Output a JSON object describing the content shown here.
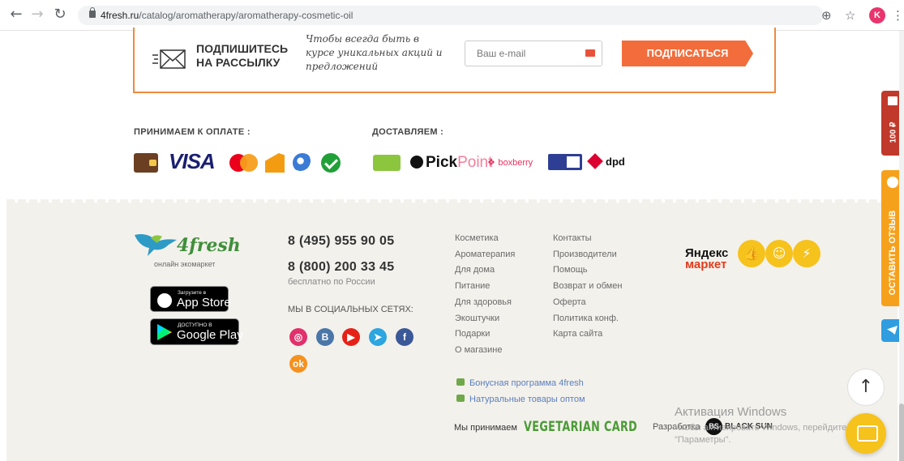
{
  "browser": {
    "url_host": "4fresh.ru",
    "url_path": "/catalog/aromatherapy/aromatherapy-cosmetic-oil",
    "back_icon": "arrow-left-icon",
    "forward_icon": "arrow-right-icon",
    "reload_icon": "reload-icon",
    "profile_initial": "K"
  },
  "subscribe": {
    "title_line1": "ПОДПИШИТЕСЬ",
    "title_line2": "НА РАССЫЛКУ",
    "note": "Чтобы всегда быть в курсе уникальных акций и предложений",
    "email_placeholder": "Ваш e-mail",
    "button_label": "ПОДПИСАТЬСЯ"
  },
  "payment": {
    "title": "ПРИНИМАЕМ К ОПЛАТЕ :",
    "visa": "VISA"
  },
  "delivery": {
    "title": "ДОСТАВЛЯЕМ :",
    "pickpoint_a": "Pick",
    "pickpoint_b": "Point",
    "boxberry": "boxberry",
    "dpd": "dpd"
  },
  "footer": {
    "logo_text": "4fresh",
    "logo_sub": "онлайн экомаркет",
    "appstore_small": "Загрузите в",
    "appstore_big": "App Store",
    "googleplay_small": "ДОСТУПНО В",
    "googleplay_big": "Google Play",
    "phone1": "8 (495) 955 90 05",
    "phone2": "8 (800) 200 33 45",
    "phone_note": "бесплатно по России",
    "social_title": "МЫ В СОЦИАЛЬНЫХ СЕТЯХ:",
    "links_col1": [
      "Косметика",
      "Ароматерапия",
      "Для дома",
      "Питание",
      "Для здоровья",
      "Экоштучки",
      "Подарки",
      "О магазине"
    ],
    "links_col2": [
      "Контакты",
      "Производители",
      "Помощь",
      "Возврат и обмен",
      "Оферта",
      "Политика конф.",
      "Карта сайта"
    ],
    "promo1": "Бонусная программа 4fresh",
    "promo2": "Натуральные товары оптом",
    "veg_label": "Мы принимаем",
    "veg_card": "VEGETARIAN CARD",
    "ym_line1": "Яндекс",
    "ym_line2": "маркет",
    "dev_label": "Разработка",
    "dev_logo": "BS",
    "dev_name": "BLACK SUN"
  },
  "overlay": {
    "win_title": "Активация Windows",
    "win_text": "Чтобы активировать Windows, перейдите в раздел \"Параметры\"."
  },
  "side": {
    "gift_label": "100 ₽",
    "review_label": "ОСТАВИТЬ ОТЗЫВ"
  },
  "colors": {
    "accent": "#f26d3b",
    "brand_green": "#3f8f3a",
    "yellow": "#f6c21c"
  }
}
